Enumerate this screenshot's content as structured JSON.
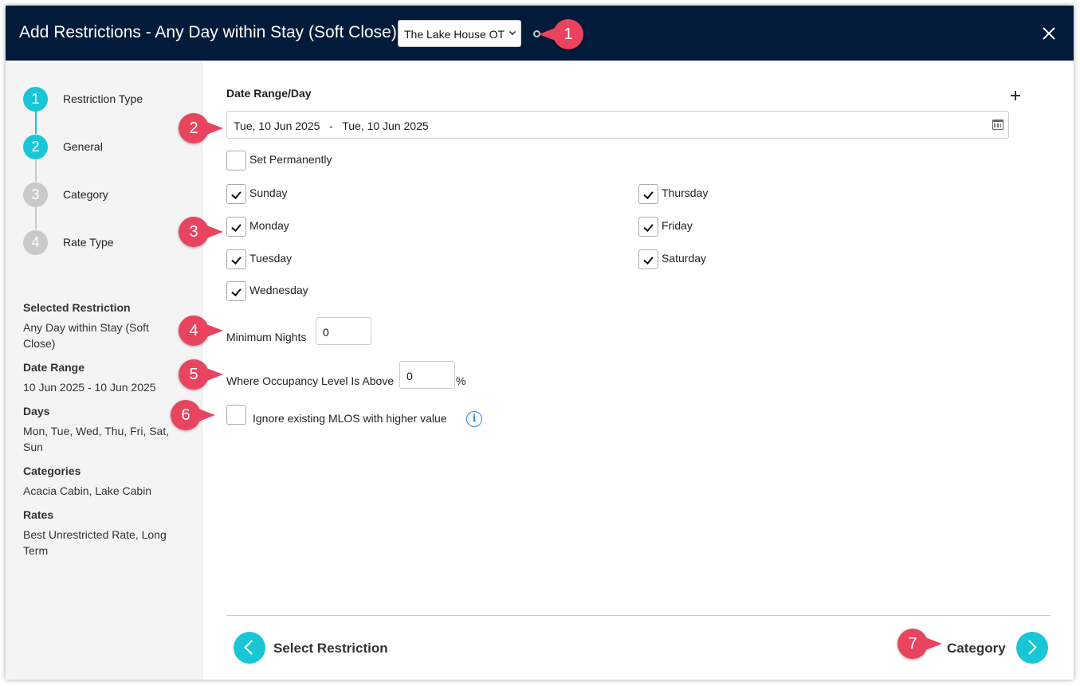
{
  "header": {
    "title": "Add Restrictions - Any Day within Stay (Soft Close)",
    "property_select": "The Lake House OT"
  },
  "steps": [
    {
      "number": "1",
      "label": "Restriction Type"
    },
    {
      "number": "2",
      "label": "General"
    },
    {
      "number": "3",
      "label": "Category"
    },
    {
      "number": "4",
      "label": "Rate Type"
    }
  ],
  "summary": {
    "selected_restriction_h": "Selected Restriction",
    "selected_restriction_v": "Any Day within Stay (Soft Close)",
    "date_range_h": "Date Range",
    "date_range_v": "10 Jun 2025 - 10 Jun 2025",
    "days_h": "Days",
    "days_v": "Mon, Tue, Wed, Thu, Fri, Sat, Sun",
    "categories_h": "Categories",
    "categories_v": "Acacia Cabin, Lake Cabin",
    "rates_h": "Rates",
    "rates_v": "Best Unrestricted Rate, Long Term"
  },
  "form": {
    "section_title": "Date Range/Day",
    "date_range": "Tue, 10 Jun 2025   -   Tue, 10 Jun 2025",
    "set_permanently": "Set Permanently",
    "days": {
      "sunday": "Sunday",
      "monday": "Monday",
      "tuesday": "Tuesday",
      "wednesday": "Wednesday",
      "thursday": "Thursday",
      "friday": "Friday",
      "saturday": "Saturday"
    },
    "minimum_nights_label": "Minimum Nights",
    "minimum_nights_value": "0",
    "occupancy_label": "Where Occupancy Level Is Above",
    "occupancy_value": "0",
    "occupancy_unit": "%",
    "ignore_mlos": "Ignore existing MLOS with higher value",
    "info_glyph": "i"
  },
  "footer": {
    "back_label": "Select Restriction",
    "next_label": "Category"
  },
  "callouts": [
    "1",
    "2",
    "3",
    "4",
    "5",
    "6",
    "7"
  ],
  "colors": {
    "header_bg": "#021b3a",
    "accent": "#19c6d6",
    "callout": "#e9445f",
    "info": "#2b86d9"
  },
  "icons": [
    "close-icon",
    "plus-icon",
    "calendar-icon",
    "info-icon",
    "chevron-left-icon",
    "chevron-right-icon",
    "chevron-down-icon"
  ]
}
